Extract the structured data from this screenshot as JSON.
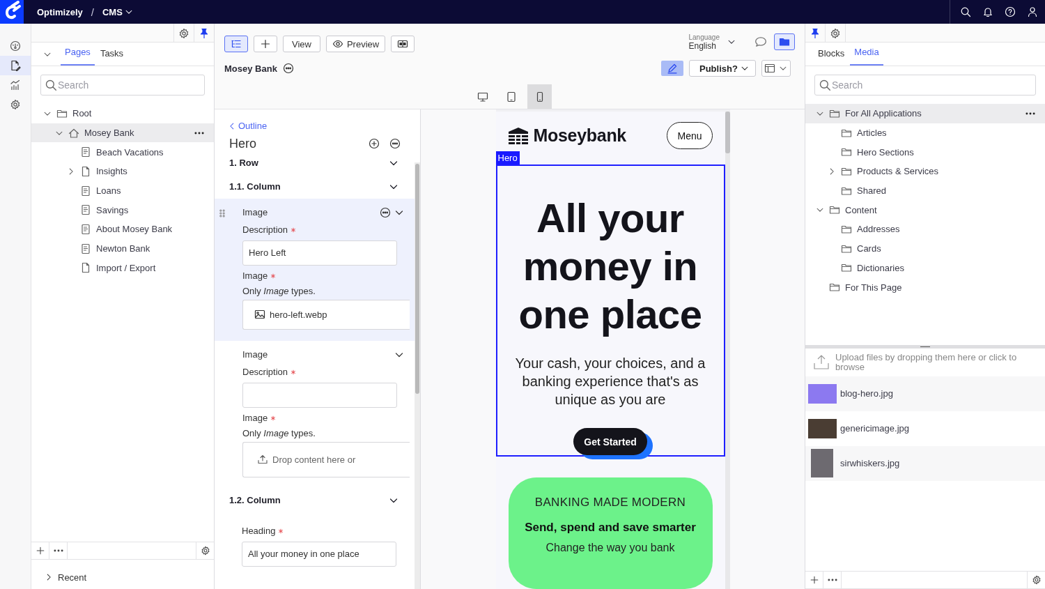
{
  "top_bar": {
    "product": "Optimizely",
    "separator": "/",
    "app": "CMS"
  },
  "rail": [
    {
      "kind": "dashboard",
      "selected": false
    },
    {
      "kind": "edit",
      "selected": true
    },
    {
      "kind": "analytics",
      "selected": false
    },
    {
      "kind": "settings",
      "selected": false
    }
  ],
  "left_panel": {
    "tabs": [
      {
        "label": "Pages",
        "selected": true
      },
      {
        "label": "Tasks",
        "selected": false
      }
    ],
    "search": {
      "placeholder": "Search"
    },
    "tree": [
      {
        "label": "Root",
        "kind": "folder",
        "selected": false,
        "expanded": true,
        "children": [
          {
            "label": "Mosey Bank",
            "kind": "home",
            "selected": true,
            "expanded": true,
            "children": [
              {
                "label": "Beach Vacations",
                "kind": "page",
                "selected": false
              },
              {
                "label": "Insights",
                "kind": "blank",
                "selected": false,
                "expanded": false
              },
              {
                "label": "Loans",
                "kind": "page",
                "selected": false
              },
              {
                "label": "Savings",
                "kind": "page",
                "selected": false
              },
              {
                "label": "About Mosey Bank",
                "kind": "page",
                "selected": false
              },
              {
                "label": "Newton Bank",
                "kind": "page",
                "selected": false
              },
              {
                "label": "Import / Export",
                "kind": "blank",
                "selected": false
              }
            ]
          }
        ]
      }
    ],
    "recent": "Recent"
  },
  "toolbar": {
    "buttons": [
      {
        "kind": "outline",
        "selected": true
      },
      {
        "kind": "add",
        "selected": false
      },
      {
        "kind": "text",
        "label": "View",
        "selected": false
      },
      {
        "kind": "preview",
        "label": "Preview",
        "selected": false
      },
      {
        "kind": "compare",
        "selected": false
      }
    ],
    "page_title": "Mosey Bank",
    "language": {
      "label": "Language",
      "value": "English"
    },
    "assets_toggle": {
      "selected": true
    },
    "edit_toggle": {
      "selected": true
    },
    "publish": "Publish?",
    "devices": [
      {
        "kind": "desktop",
        "selected": false
      },
      {
        "kind": "tablet",
        "selected": false
      },
      {
        "kind": "phone",
        "selected": true
      }
    ]
  },
  "outline": {
    "back": "Outline",
    "title": "Hero",
    "items": [
      {
        "kind": "group",
        "label": "1. Row"
      },
      {
        "kind": "group",
        "label": "1.1. Column"
      },
      {
        "kind": "block",
        "title": "Image",
        "selected": true,
        "fields": [
          {
            "kind": "text",
            "label": "Description",
            "required": true,
            "value": "Hero Left"
          },
          {
            "kind": "content",
            "label": "Image",
            "required": true,
            "hint": "Only *Image* types.",
            "value": "hero-left.webp"
          }
        ]
      },
      {
        "kind": "block",
        "title": "Image",
        "selected": false,
        "fields": [
          {
            "kind": "text",
            "label": "Description",
            "required": true
          },
          {
            "kind": "content",
            "label": "Image",
            "required": true,
            "hint": "Only *Image* types.",
            "drop_text": "Drop content here or"
          }
        ]
      },
      {
        "kind": "group",
        "label": "1.2. Column"
      },
      {
        "kind": "text",
        "label": "Heading",
        "required": true,
        "value": "All your money in one place"
      }
    ]
  },
  "preview": {
    "brand": "Moseybank",
    "menu": "Menu",
    "selection_tag": "Hero",
    "headline": "All your money in one place",
    "subtitle": "Your cash, your choices, and a banking experience that's as unique as you are",
    "cta": "Get Started",
    "card": {
      "eyebrow": "BANKING MADE MODERN",
      "title": "Send, spend and save smarter",
      "text": "Change the way you bank"
    }
  },
  "right_panel": {
    "tabs": [
      {
        "label": "Blocks",
        "selected": false
      },
      {
        "label": "Media",
        "selected": true
      }
    ],
    "search": {
      "placeholder": "Search"
    },
    "tree": [
      {
        "label": "For All Applications",
        "kind": "folder",
        "selected": true,
        "expanded": true,
        "children": [
          {
            "label": "Articles",
            "kind": "folder",
            "selected": false
          },
          {
            "label": "Hero Sections",
            "kind": "folder",
            "selected": false
          },
          {
            "label": "Products & Services",
            "kind": "folder",
            "selected": false,
            "expanded": false
          },
          {
            "label": "Shared",
            "kind": "folder",
            "selected": false
          }
        ]
      },
      {
        "label": "Content",
        "kind": "folder",
        "selected": false,
        "expanded": true,
        "children": [
          {
            "label": "Addresses",
            "kind": "folder",
            "selected": false
          },
          {
            "label": "Cards",
            "kind": "folder",
            "selected": false
          },
          {
            "label": "Dictionaries",
            "kind": "folder",
            "selected": false
          }
        ]
      },
      {
        "label": "For This Page",
        "kind": "folder",
        "selected": false
      }
    ],
    "upload_hint": "Upload files by dropping them here or click to browse",
    "files": [
      {
        "name": "blog-hero.jpg"
      },
      {
        "name": "genericimage.jpg"
      },
      {
        "name": "sirwhiskers.jpg"
      }
    ]
  }
}
